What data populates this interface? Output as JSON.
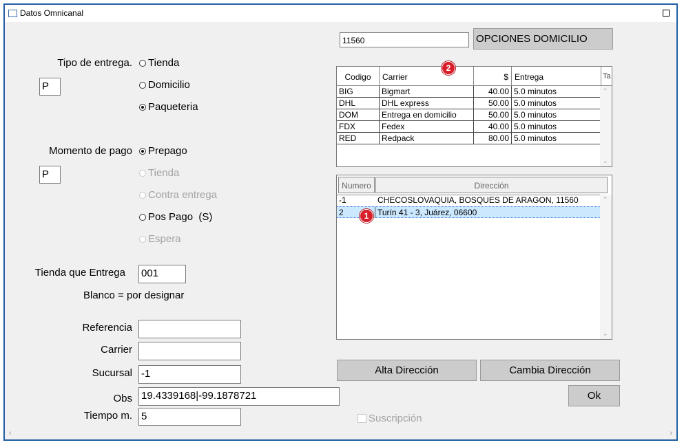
{
  "window": {
    "title": "Datos Omnicanal"
  },
  "left": {
    "tipo_entrega_label": "Tipo de entrega.",
    "tipo_entrega_code": "P",
    "tipo_entrega_options": [
      "Tienda",
      "Domicilio",
      "Paqueteria"
    ],
    "momento_pago_label": "Momento de pago",
    "momento_pago_code": "P",
    "momento_pago_options": [
      "Prepago",
      "Tienda",
      "Contra entrega",
      "Pos Pago  (S)",
      "Espera"
    ],
    "tienda_entrega_label": "Tienda que Entrega",
    "tienda_entrega_value": "001",
    "blanco_note": "Blanco = por designar",
    "referencia_label": "Referencia",
    "referencia_value": "",
    "carrier_label": "Carrier",
    "carrier_value": "",
    "sucursal_label": "Sucursal",
    "sucursal_value": "-1",
    "obs_label": "Obs",
    "obs_value": "19.4339168|-99.1878721",
    "tiempo_label": "Tiempo m.",
    "tiempo_value": "5"
  },
  "right": {
    "cp_value": "11560",
    "opciones_button": "OPCIONES DOMICILIO",
    "carrier_grid": {
      "headers": [
        "Codigo",
        "Carrier",
        "$",
        "Entrega",
        "Ta"
      ],
      "rows": [
        [
          "BIG",
          "Bigmart",
          "40.00",
          "5.0 minutos"
        ],
        [
          "DHL",
          "DHL express",
          "50.00",
          "5.0 minutos"
        ],
        [
          "DOM",
          "Entrega en domicilio",
          "50.00",
          "5.0 minutos"
        ],
        [
          "FDX",
          "Fedex",
          "40.00",
          "5.0 minutos"
        ],
        [
          "RED",
          "Redpack",
          "80.00",
          "5.0 minutos"
        ]
      ]
    },
    "address_grid": {
      "headers": [
        "Numero",
        "Dirección"
      ],
      "rows": [
        [
          "-1",
          "CHECOSLOVAQUIA, BOSQUES DE ARAGON, 11560"
        ],
        [
          "2",
          "Turín 41 - 3, Juárez, 06600"
        ]
      ]
    },
    "alta_button": "Alta Dirección",
    "cambia_button": "Cambia Dirección",
    "ok_button": "Ok",
    "suscripcion_label": "Suscripción"
  },
  "badges": {
    "one": "1",
    "two": "2"
  },
  "colors": {
    "frame": "#1f5fa3",
    "badge": "#d81e2a",
    "selected_row": "#cce8ff"
  }
}
